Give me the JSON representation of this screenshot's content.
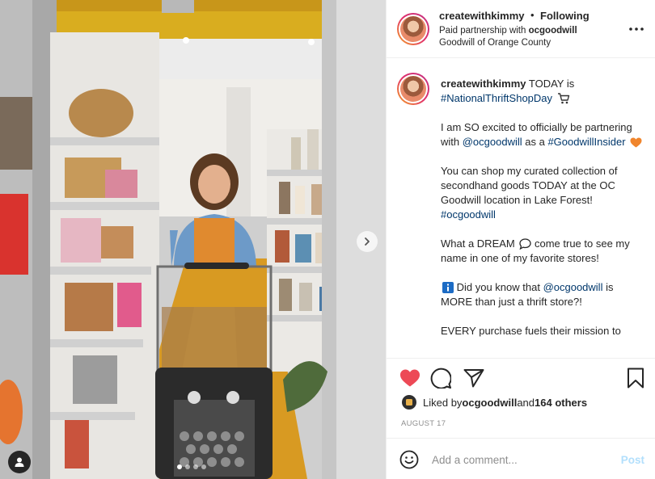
{
  "header": {
    "username": "createwithkimmy",
    "separator": "•",
    "follow_status": "Following",
    "paid_prefix": "Paid partnership with ",
    "partner": "ocgoodwill",
    "location": "Goodwill of Orange County"
  },
  "caption": {
    "username": "createwithkimmy",
    "line1_text": " TODAY is ",
    "line1_tag": "#NationalThriftShopDay",
    "p2_text": "I am SO excited to officially be partnering with ",
    "p2_mention": "@ocgoodwill",
    "p2_mid": " as a ",
    "p2_tag": "#GoodwillInsider",
    "p3_text": "You can shop my curated collection of secondhand goods TODAY at the OC Goodwill location in Lake Forest! ",
    "p3_tag": "#ocgoodwill",
    "p4_a": "What a DREAM ",
    "p4_b": " come true to see my name in one of my favorite stores!",
    "p5_a": " Did you know that ",
    "p5_mention": "@ocgoodwill",
    "p5_b": " is MORE than just a thrift store?!",
    "p6": "EVERY purchase fuels their mission to"
  },
  "likes": {
    "prefix": "Liked by ",
    "user": "ocgoodwill",
    "and": " and ",
    "others": "164 others"
  },
  "date": "AUGUST 17",
  "comment": {
    "placeholder": "Add a comment...",
    "post_label": "Post"
  },
  "icons": {
    "like": "heart-filled-icon",
    "comment": "comment-icon",
    "share": "paper-plane-icon",
    "save": "bookmark-icon",
    "more": "more-horizontal-icon",
    "next": "chevron-right-icon",
    "user_tags": "user-tag-icon",
    "emoji": "emoji-smile-icon"
  },
  "colors": {
    "like_red": "#ed4956",
    "link_blue": "#00376b",
    "post_disabled": "#b2dffc",
    "secondary_text": "#8e8e8e"
  },
  "carousel": {
    "total": 4,
    "active": 1
  }
}
